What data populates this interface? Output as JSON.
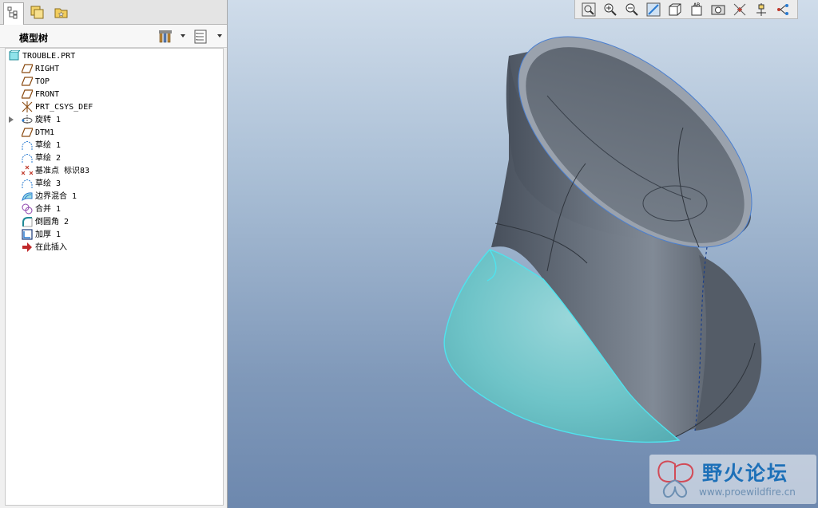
{
  "panel": {
    "tabs": [
      {
        "name": "model-tree-icon",
        "active": true
      },
      {
        "name": "layers-icon",
        "active": false
      },
      {
        "name": "folder-browser-icon",
        "active": false
      }
    ],
    "title": "模型树",
    "settings_icon": "tree-settings-icon",
    "show_icon": "show-columns-icon"
  },
  "tree": {
    "items": [
      {
        "label": "TROUBLE.PRT",
        "icon": "part-icon"
      },
      {
        "label": "RIGHT",
        "icon": "datum-plane-icon"
      },
      {
        "label": "TOP",
        "icon": "datum-plane-icon"
      },
      {
        "label": "FRONT",
        "icon": "datum-plane-icon"
      },
      {
        "label": "PRT_CSYS_DEF",
        "icon": "coordinate-system-icon"
      },
      {
        "label": "旋转 1",
        "icon": "revolve-icon"
      },
      {
        "label": "DTM1",
        "icon": "datum-plane-icon"
      },
      {
        "label": "草绘 1",
        "icon": "sketch-icon"
      },
      {
        "label": "草绘 2",
        "icon": "sketch-icon"
      },
      {
        "label": "基准点 标识83",
        "icon": "datum-point-icon"
      },
      {
        "label": "草绘 3",
        "icon": "sketch-icon"
      },
      {
        "label": "边界混合 1",
        "icon": "boundary-blend-icon"
      },
      {
        "label": "合并 1",
        "icon": "merge-icon"
      },
      {
        "label": "倒圆角 2",
        "icon": "round-icon"
      },
      {
        "label": "加厚 1",
        "icon": "thicken-icon"
      },
      {
        "label": "在此插入",
        "icon": "insert-here-icon"
      }
    ]
  },
  "toolbar": {
    "buttons": [
      "zoom-fit-icon",
      "zoom-in-icon",
      "zoom-out-icon",
      "repaint-icon",
      "display-style-icon",
      "saved-views-icon",
      "view-manager-icon",
      "datum-display-icon",
      "spin-center-icon",
      "annotation-display-icon"
    ]
  },
  "watermark": {
    "title": "野火论坛",
    "url": "www.proewildfire.cn"
  },
  "colors": {
    "model_gray": "#5c6470",
    "selected_cyan": "#6fc4c8",
    "edge_highlight": "#4fe3ee",
    "viewport_top": "#cfdcea",
    "viewport_bottom": "#6d88ae"
  }
}
